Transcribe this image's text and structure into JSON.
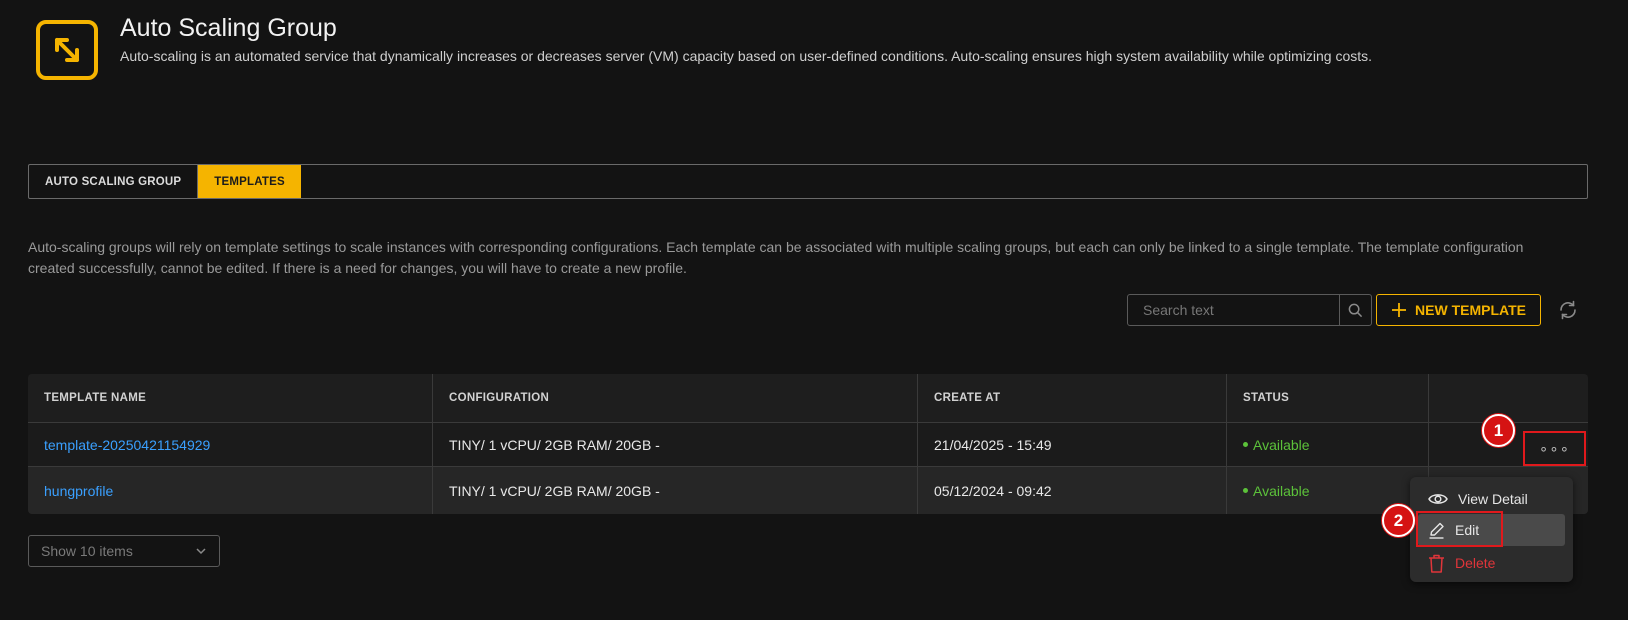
{
  "header": {
    "logo_icon": "expand-arrows-icon",
    "title": "Auto Scaling Group",
    "description": "Auto-scaling is an automated service that dynamically increases or decreases server (VM) capacity based on user-defined conditions. Auto-scaling ensures high system availability while optimizing costs."
  },
  "tabs": [
    {
      "label": "AUTO SCALING GROUP",
      "active": false
    },
    {
      "label": "TEMPLATES",
      "active": true
    }
  ],
  "info_text": "Auto-scaling groups will rely on template settings to scale instances with corresponding configurations. Each template can be associated with multiple scaling groups, but each can only be linked to a single template. The template configuration created successfully, cannot be edited. If there is a need for changes, you will have to create a new profile.",
  "toolbar": {
    "search_placeholder": "Search text",
    "new_template_label": "NEW TEMPLATE"
  },
  "table": {
    "columns": [
      "TEMPLATE NAME",
      "CONFIGURATION",
      "CREATE AT",
      "STATUS"
    ],
    "rows": [
      {
        "name": "template-20250421154929",
        "configuration": "TINY/ 1 vCPU/ 2GB RAM/ 20GB -",
        "created_at": "21/04/2025 - 15:49",
        "status": "Available"
      },
      {
        "name": "hungprofile",
        "configuration": "TINY/ 1 vCPU/ 2GB RAM/ 20GB -",
        "created_at": "05/12/2024 - 09:42",
        "status": "Available"
      }
    ],
    "more_label": "∘∘∘"
  },
  "pagination": {
    "page_size_label": "Show 10 items"
  },
  "menu": {
    "view_label": "View Detail",
    "edit_label": "Edit",
    "delete_label": "Delete"
  },
  "annotations": {
    "badge1": "1",
    "badge2": "2"
  },
  "colors": {
    "accent": "#f5b400",
    "link": "#3aa0ff",
    "status_available": "#5cc23a",
    "danger": "#e0353a",
    "annotation_red": "#d51313"
  }
}
